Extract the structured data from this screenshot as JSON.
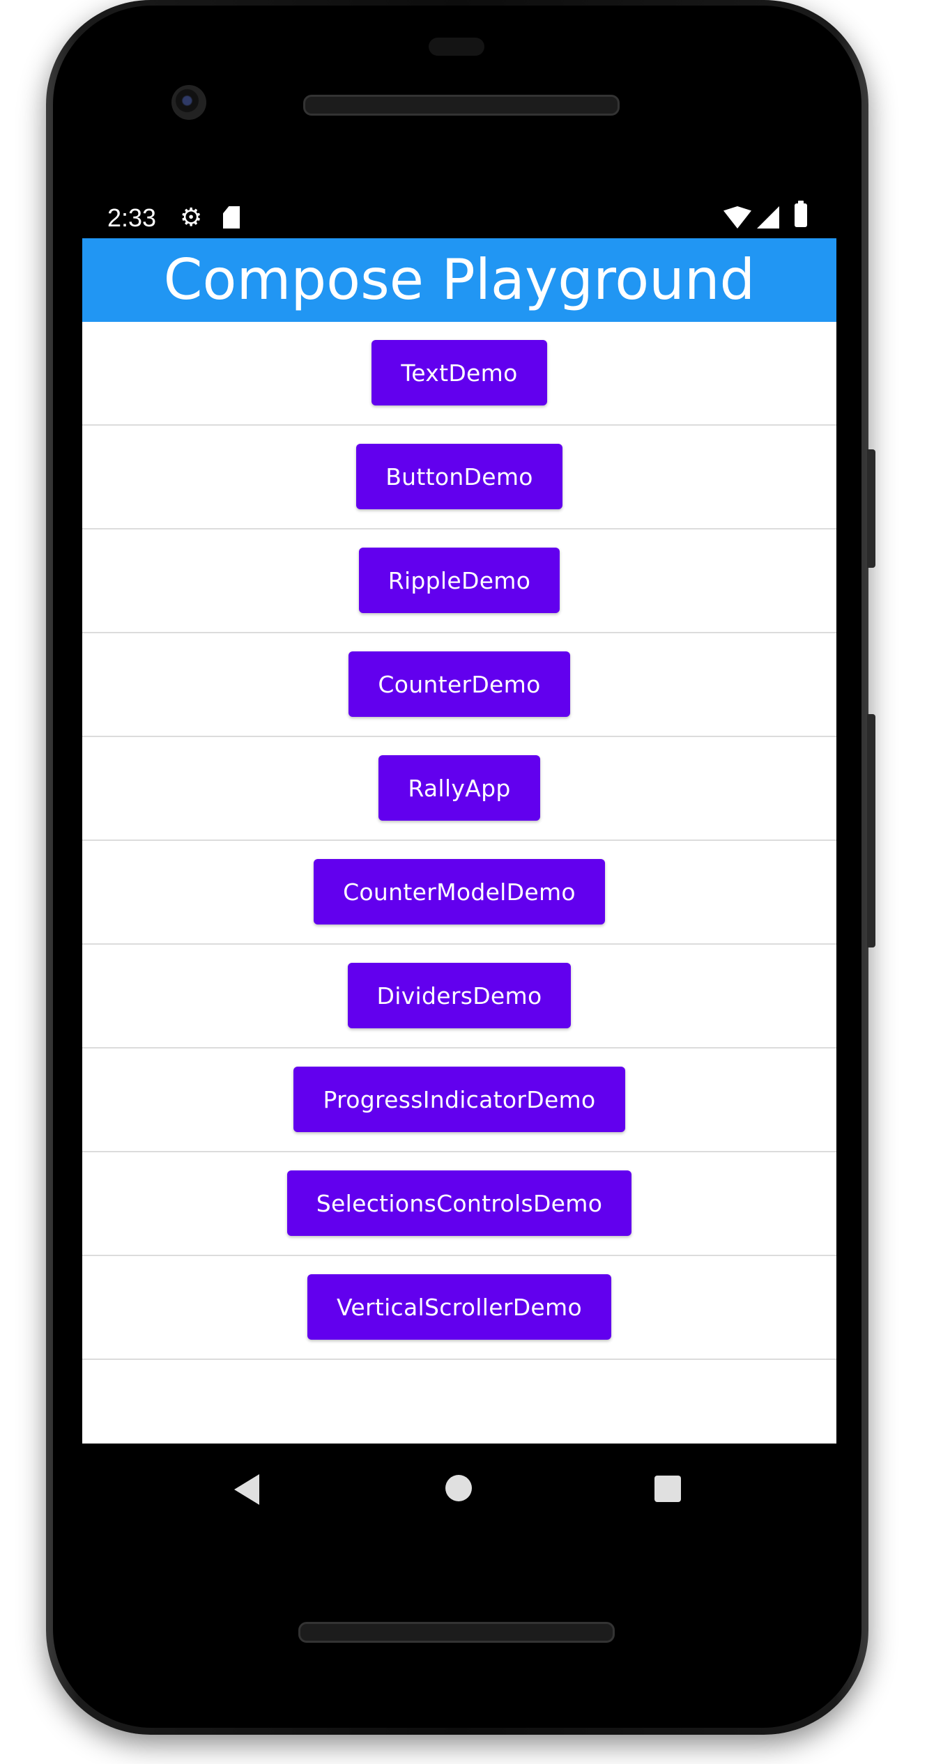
{
  "status_bar": {
    "time": "2:33",
    "icons": [
      "gear-icon",
      "sd-card-icon",
      "wifi-icon",
      "signal-icon",
      "battery-icon"
    ]
  },
  "app_bar": {
    "title": "Compose Playground",
    "color": "#2196F3"
  },
  "buttons": {
    "color": "#6200EE",
    "items": [
      {
        "label": "TextDemo"
      },
      {
        "label": "ButtonDemo"
      },
      {
        "label": "RippleDemo"
      },
      {
        "label": "CounterDemo"
      },
      {
        "label": "RallyApp"
      },
      {
        "label": "CounterModelDemo"
      },
      {
        "label": "DividersDemo"
      },
      {
        "label": "ProgressIndicatorDemo"
      },
      {
        "label": "SelectionsControlsDemo"
      },
      {
        "label": "VerticalScrollerDemo"
      }
    ]
  },
  "nav_bar": {
    "icons": [
      "back-icon",
      "home-icon",
      "recents-icon"
    ]
  }
}
